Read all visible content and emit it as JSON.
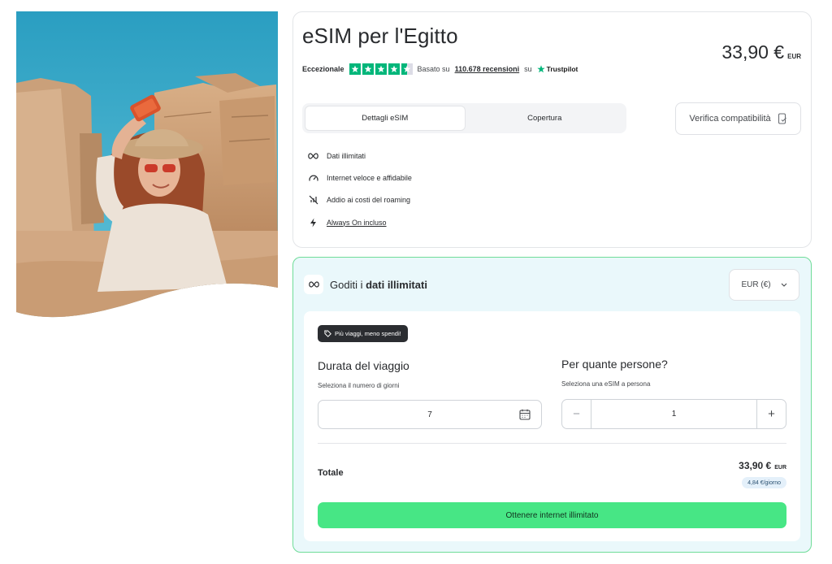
{
  "product": {
    "title": "eSIM per l'Egitto",
    "price": "33,90 €",
    "currency_code": "EUR"
  },
  "rating": {
    "word": "Eccezionale",
    "stars": 4.5,
    "based_on": "Basato su",
    "reviews_link": "110.678 recensioni",
    "on": "su",
    "provider": "Trustpilot"
  },
  "tabs": [
    {
      "label": "Dettagli eSIM",
      "active": true
    },
    {
      "label": "Copertura",
      "active": false
    }
  ],
  "verify_button": {
    "label": "Verifica compatibilità",
    "icon": "phone-check-icon"
  },
  "features": [
    {
      "icon": "infinity-icon",
      "label": "Dati illimitati"
    },
    {
      "icon": "speedometer-icon",
      "label": "Internet veloce e affidabile"
    },
    {
      "icon": "no-roaming-icon",
      "label": "Addio ai costi del roaming"
    },
    {
      "icon": "bolt-icon",
      "label": "Always On incluso"
    }
  ],
  "plan": {
    "title_prefix": "Goditi i",
    "title_bold": "dati illimitati",
    "currency_select": "EUR (€)",
    "badge": "Più viaggi, meno spendi!",
    "duration": {
      "label": "Durata del viaggio",
      "sub": "Seleziona il numero di giorni",
      "value": "7"
    },
    "people": {
      "label": "Per quante persone?",
      "sub": "Seleziona una eSIM a persona",
      "value": "1",
      "minus": "−",
      "plus": "+"
    },
    "total": {
      "label": "Totale",
      "price": "33,90 €",
      "currency_code": "EUR",
      "per_day": "4,84 €/giorno"
    },
    "cta": "Ottenere internet illimitato"
  },
  "colors": {
    "accent_green": "#47e685",
    "trustpilot_green": "#00b67a",
    "panel_border": "#6fdc98",
    "panel_bg": "#eaf8fb"
  }
}
